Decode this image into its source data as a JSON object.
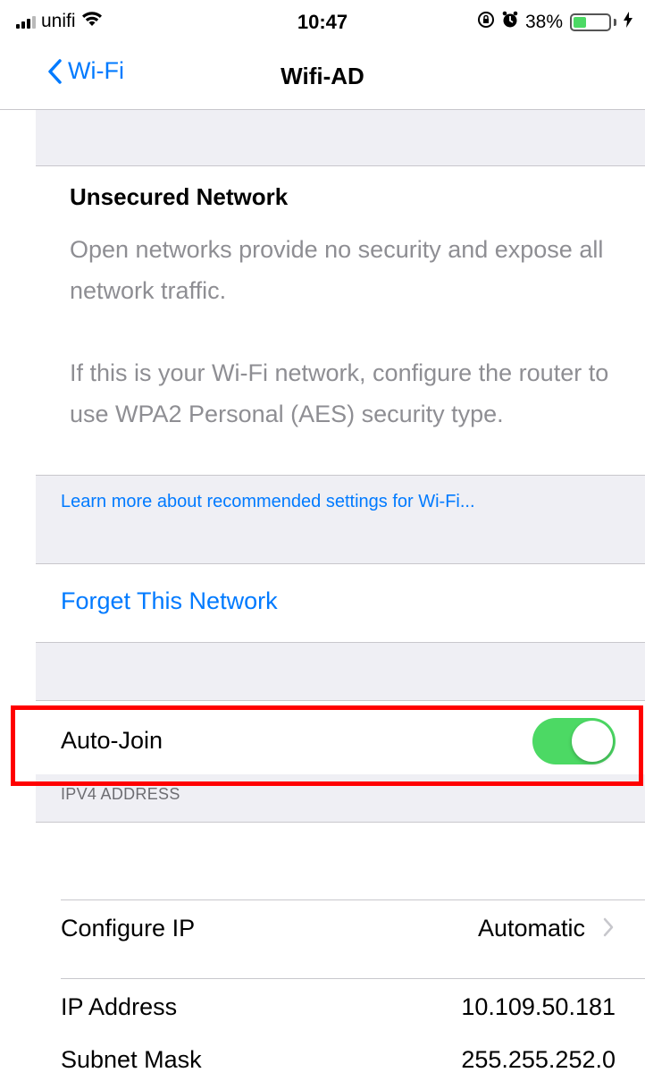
{
  "status_bar": {
    "carrier": "unifi",
    "time": "10:47",
    "battery_percent": "38%",
    "battery_level": 0.38,
    "icons": [
      "signal-icon",
      "wifi-icon",
      "orientation-lock-icon",
      "alarm-icon",
      "battery-icon",
      "charging-icon"
    ]
  },
  "nav": {
    "back_label": "Wi-Fi",
    "title": "Wifi-AD"
  },
  "security_notice": {
    "title": "Unsecured Network",
    "body": "Open networks provide no security and expose all network traffic.\n\nIf this is your Wi-Fi network, configure the router to use WPA2 Personal (AES) security type.",
    "learn_more": "Learn more about recommended settings for Wi-Fi..."
  },
  "actions": {
    "forget": "Forget This Network"
  },
  "auto_join": {
    "label": "Auto-Join",
    "enabled": true
  },
  "ipv4": {
    "header": "IPV4 ADDRESS",
    "rows": [
      {
        "label": "Configure IP",
        "value": "Automatic"
      },
      {
        "label": "IP Address",
        "value": "10.109.50.181"
      },
      {
        "label": "Subnet Mask",
        "value": "255.255.252.0"
      }
    ]
  },
  "colors": {
    "accent": "#007aff",
    "toggle_on": "#4cd964",
    "highlight": "#ff0000",
    "secondary_text": "#8e8e93",
    "group_background": "#efeff4"
  }
}
